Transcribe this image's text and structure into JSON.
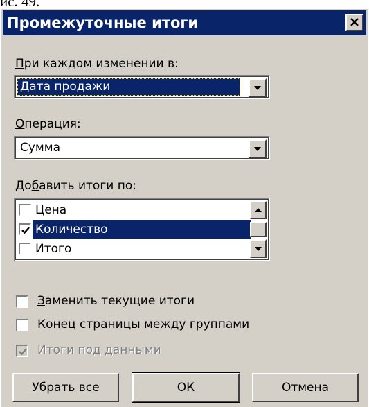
{
  "doc_fragment": "ис. 49.",
  "dialog": {
    "title": "Промежуточные итоги",
    "close_symbol": "×"
  },
  "group_by": {
    "accel": "П",
    "label_rest": "ри каждом изменении в:",
    "value": "Дата продажи"
  },
  "operation": {
    "accel": "О",
    "label_rest": "перация:",
    "value": "Сумма"
  },
  "add_totals": {
    "label_before": "До",
    "accel": "б",
    "label_after": "авить итоги по:",
    "items": [
      {
        "label": "Цена",
        "checked": false,
        "selected": false
      },
      {
        "label": "Количество",
        "checked": true,
        "selected": true
      },
      {
        "label": "Итого",
        "checked": false,
        "selected": false
      }
    ]
  },
  "options": {
    "replace": {
      "accel": "З",
      "rest": "аменить текущие итоги",
      "checked": false
    },
    "page_break": {
      "accel": "К",
      "rest": "онец страницы между группами",
      "checked": false
    },
    "summary_below": {
      "label": "Итоги под данными",
      "checked": true,
      "enabled": false
    }
  },
  "buttons": {
    "remove_all": {
      "accel": "У",
      "rest": "брать все"
    },
    "ok": "ОК",
    "cancel": "Отмена"
  },
  "colors": {
    "face": "#d4d0c8",
    "title_bar": "#0a246a",
    "selection": "#0a246a"
  }
}
